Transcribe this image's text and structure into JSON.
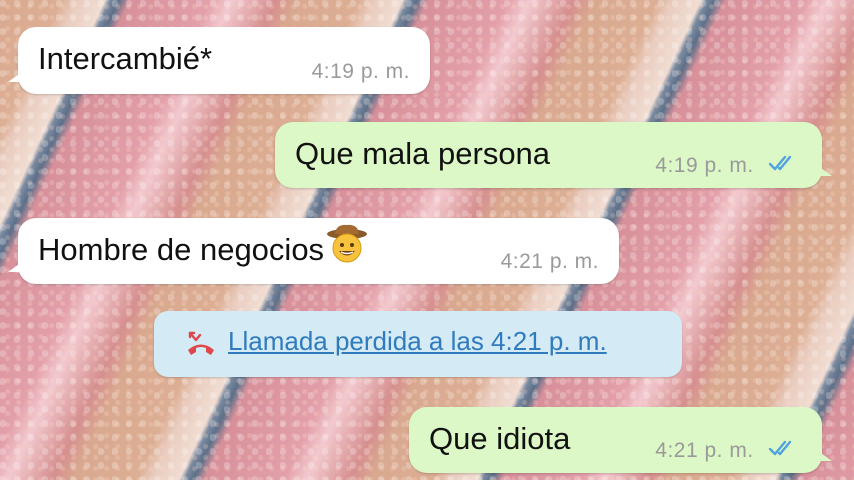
{
  "messages": [
    {
      "direction": "incoming",
      "text": "Intercambié*",
      "time": "4:19 p. m."
    },
    {
      "direction": "outgoing",
      "text": "Que mala persona",
      "time": "4:19 p. m.",
      "status": "read-double-check"
    },
    {
      "direction": "incoming",
      "text": "Hombre de negocios",
      "emoji": "cowboy-face-emoji",
      "time": "4:21 p. m."
    },
    {
      "direction": "outgoing",
      "text": "Que idiota",
      "time": "4:21 p. m.",
      "status": "read-double-check"
    }
  ],
  "system_message": {
    "icon": "missed-call-icon",
    "text": "Llamada perdida a las 4:21 p. m."
  },
  "colors": {
    "incoming_bubble": "#ffffff",
    "outgoing_bubble": "#dcf8c6",
    "system_bubble": "#d4eaf4",
    "link_text": "#2f7bbd",
    "read_ticks": "#4fa3e0",
    "missed_call_icon": "#e0474c",
    "timestamp": "#9a9a9a"
  }
}
